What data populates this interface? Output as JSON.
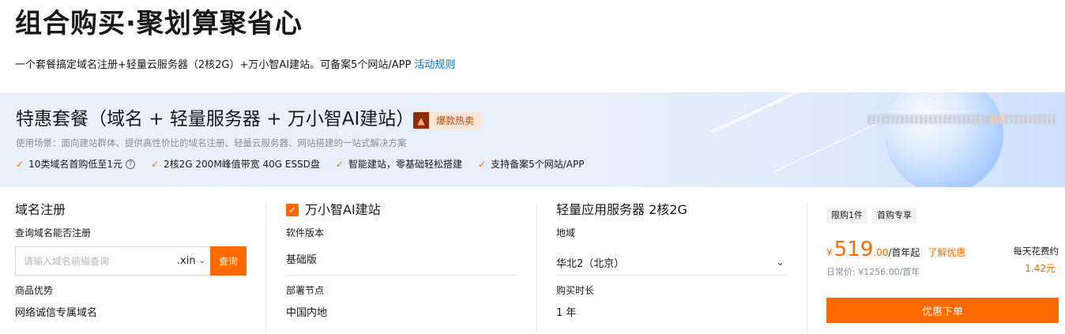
{
  "header": {
    "title": "组合购买·聚划算聚省心",
    "subtitle": "一个套餐搞定域名注册+轻量云服务器（2核2G）+万小智AI建站。可备案5个网站/APP",
    "rules_link": "活动规则"
  },
  "banner": {
    "title": "特惠套餐（域名 + 轻量服务器 + 万小智AI建站）",
    "badge": "爆款热卖",
    "scenario": "使用场景：面向建站群体、提供高性价比的域名注册、轻量云服务器、网站搭建的一站式解决方案",
    "features": [
      "10类域名首购低至1元",
      "2核2G 200M峰值带宽 40G ESSD盘",
      "智能建站，零基础轻松搭建",
      "支持备案5个网站/APP"
    ]
  },
  "domain": {
    "title": "域名注册",
    "query_label": "查询域名能否注册",
    "input_placeholder": "请输入域名前缀查询",
    "suffix": ".xin",
    "query_button": "查询",
    "advantage_label": "商品优势",
    "advantage_value": "网络诚信专属域名"
  },
  "site_builder": {
    "title": "万小智AI建站",
    "version_label": "软件版本",
    "version_value": "基础版",
    "node_label": "部署节点",
    "node_value": "中国内地"
  },
  "server": {
    "title": "轻量应用服务器 2核2G",
    "region_label": "地域",
    "region_value": "华北2（北京）",
    "duration_label": "购买时长",
    "duration_value": "1 年"
  },
  "order": {
    "tags": [
      "限购1件",
      "首购专享"
    ],
    "currency": "¥",
    "price_int": "519",
    "price_dec": ".00",
    "unit": "/首年起",
    "discount_link": "了解优惠",
    "original_price": "日常价: ¥1256.00/首年",
    "daily_label": "每天花费约",
    "daily_value": "1.42元",
    "buy_button": "优惠下单"
  },
  "colors": {
    "accent": "#ff6a00",
    "link": "#0070cc"
  }
}
